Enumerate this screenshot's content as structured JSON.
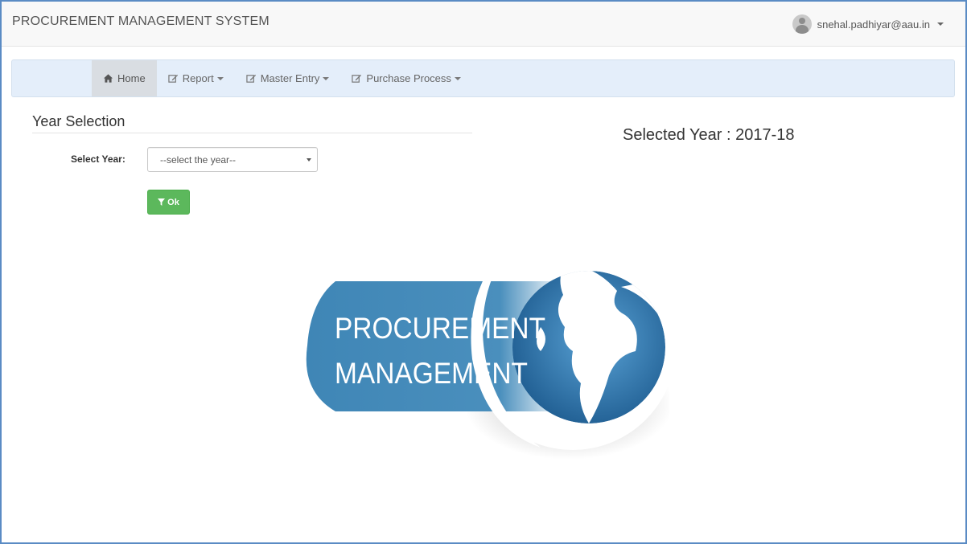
{
  "app": {
    "title": "PROCUREMENT MANAGEMENT SYSTEM",
    "user_email": "snehal.padhiyar@aau.in"
  },
  "nav": {
    "items": [
      {
        "label": "Home",
        "icon": "home-icon",
        "dropdown": false,
        "active": true
      },
      {
        "label": "Report",
        "icon": "edit-icon",
        "dropdown": true,
        "active": false
      },
      {
        "label": "Master Entry",
        "icon": "edit-icon",
        "dropdown": true,
        "active": false
      },
      {
        "label": "Purchase Process",
        "icon": "edit-icon",
        "dropdown": true,
        "active": false
      }
    ]
  },
  "year_selection": {
    "title": "Year Selection",
    "label": "Select Year:",
    "select_value": "--select the year--",
    "ok_label": "Ok",
    "selected_year_text": "Selected Year : 2017-18"
  },
  "logo": {
    "line1": "PROCUREMENT",
    "line2": "MANAGEMENT"
  },
  "colors": {
    "navbar_bg": "#e4eefa",
    "ok_button": "#5cb85c",
    "logo_blue": "#4a8fbd",
    "frame_border": "#5a8bc4"
  }
}
